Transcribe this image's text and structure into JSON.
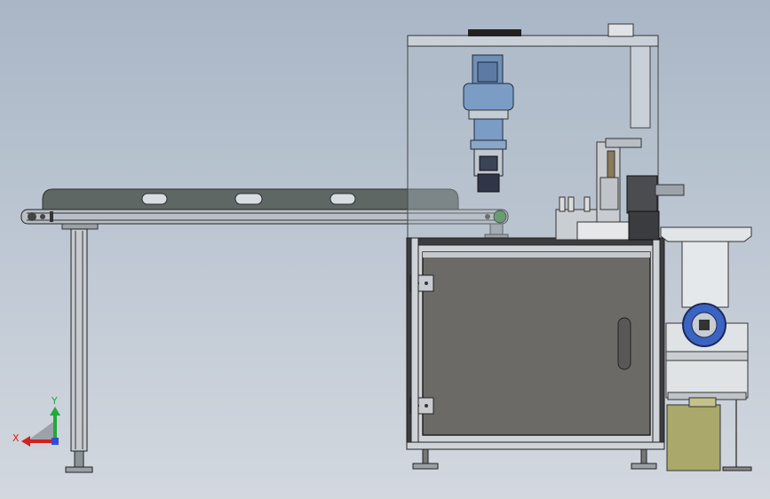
{
  "viewport": {
    "background_top": "#a9b6c6",
    "background_bottom": "#d3d8df"
  },
  "triad": {
    "x_label": "X",
    "y_label": "Y",
    "x_color": "#d32020",
    "y_color": "#22a83a",
    "z_color": "#3050d0"
  },
  "model": {
    "frame_color": "#3a3c40",
    "panel_color": "#6c6a66",
    "spindle_color": "#7b9cc4",
    "conveyor_color": "#5e6662",
    "box_color": "#aaa86a"
  }
}
